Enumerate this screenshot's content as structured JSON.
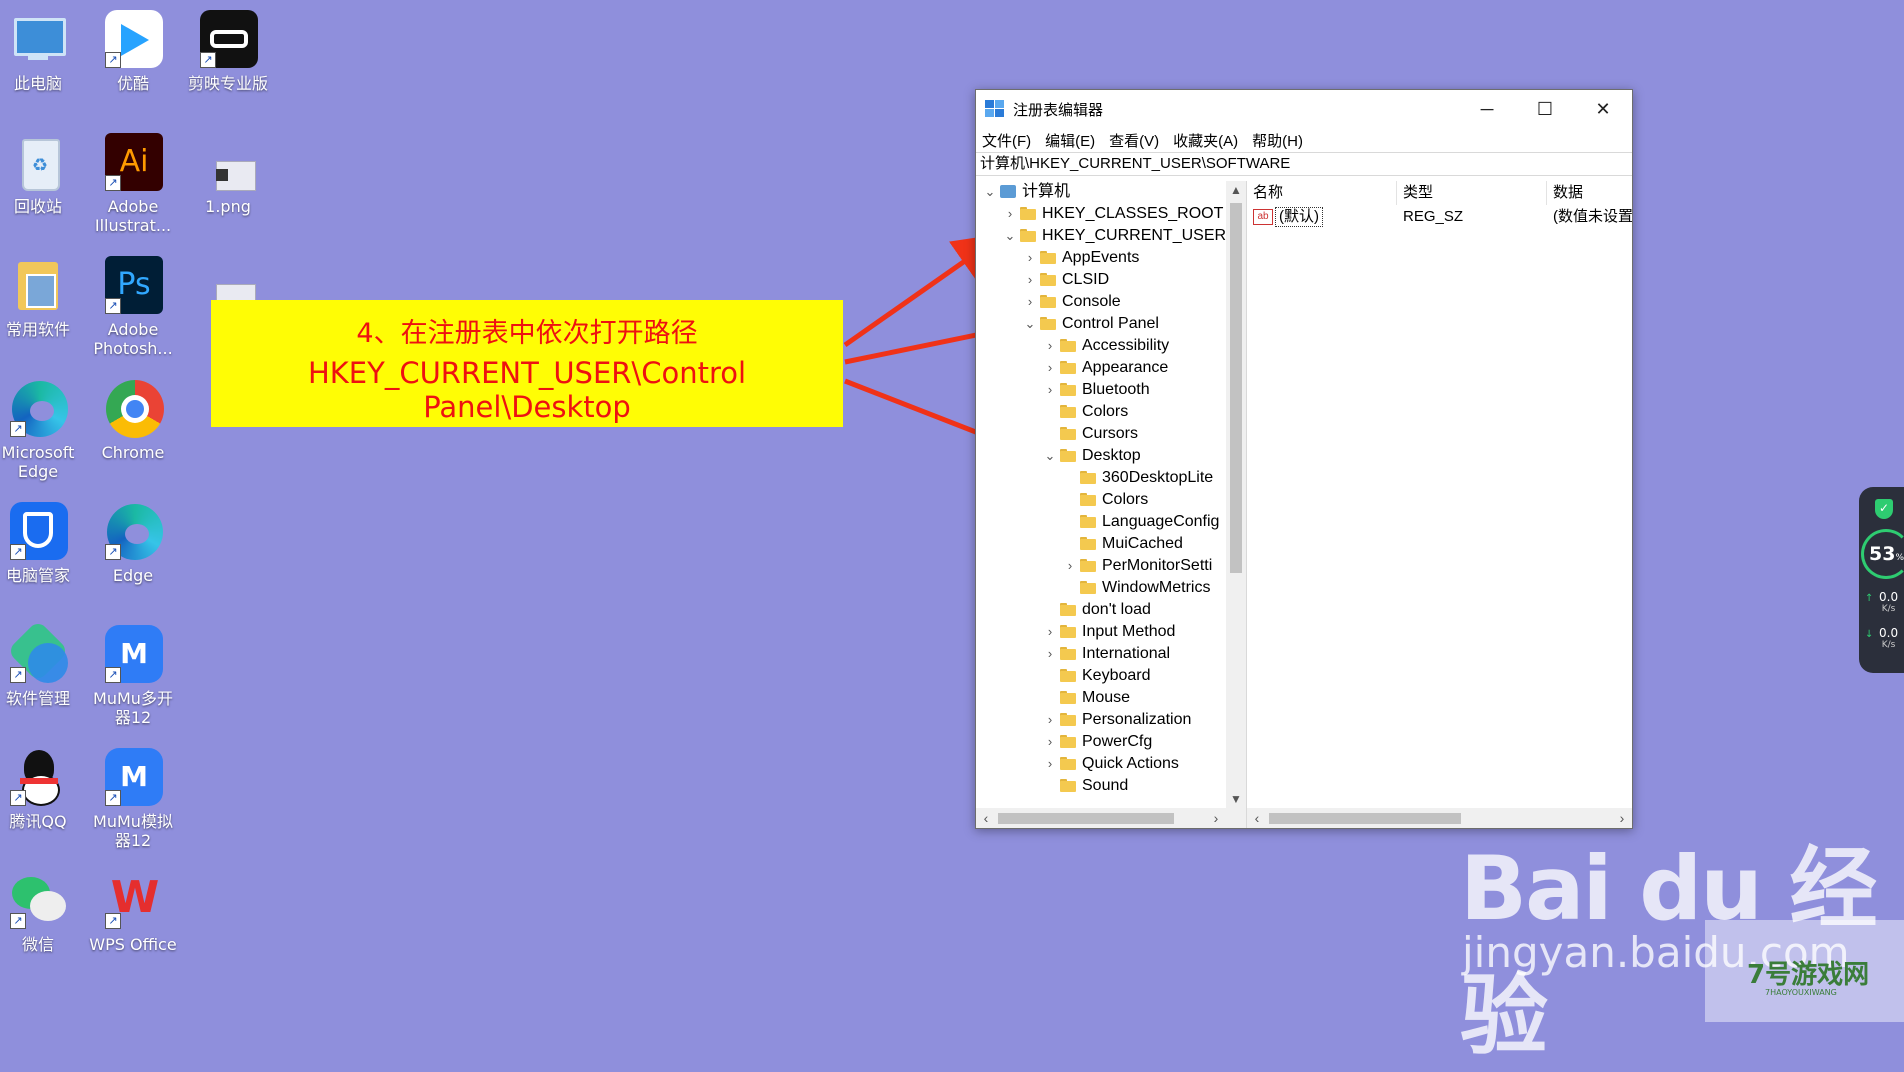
{
  "desktop": {
    "icons": [
      {
        "label": "此电脑"
      },
      {
        "label": "优酷"
      },
      {
        "label": "剪映专业版"
      },
      {
        "label": "回收站"
      },
      {
        "label": "Adobe Illustrat..."
      },
      {
        "label": "1.png"
      },
      {
        "label": "常用软件"
      },
      {
        "label": "Adobe Photosh..."
      },
      {
        "label": "Microsoft Edge"
      },
      {
        "label": "Chrome"
      },
      {
        "label": "电脑管家"
      },
      {
        "label": "Edge"
      },
      {
        "label": "软件管理"
      },
      {
        "label": "MuMu多开器12"
      },
      {
        "label": "腾讯QQ"
      },
      {
        "label": "MuMu模拟器12"
      },
      {
        "label": "微信"
      },
      {
        "label": "WPS Office"
      }
    ],
    "icon_glyphs": {
      "illustrator": "Ai",
      "photoshop": "Ps",
      "wps": "W",
      "mumu": "M"
    }
  },
  "callout": {
    "line1": "4、在注册表中依次打开路径",
    "line2": "HKEY_CURRENT_USER\\Control Panel\\Desktop",
    "background": "#fffd05",
    "text_color": "#ee1111",
    "arrow_color": "#f03218"
  },
  "regedit": {
    "title": "注册表编辑器",
    "window_buttons": {
      "minimize": "─",
      "maximize": "☐",
      "close": "✕"
    },
    "menu": [
      "文件(F)",
      "编辑(E)",
      "查看(V)",
      "收藏夹(A)",
      "帮助(H)"
    ],
    "address": "计算机\\HKEY_CURRENT_USER\\SOFTWARE",
    "tree": [
      {
        "label": "计算机",
        "level": 0,
        "expander": "v",
        "icon": "computer"
      },
      {
        "label": "HKEY_CLASSES_ROOT",
        "level": 1,
        "expander": ">"
      },
      {
        "label": "HKEY_CURRENT_USER",
        "level": 1,
        "expander": "v"
      },
      {
        "label": "AppEvents",
        "level": 2,
        "expander": ">"
      },
      {
        "label": "CLSID",
        "level": 2,
        "expander": ">"
      },
      {
        "label": "Console",
        "level": 2,
        "expander": ">"
      },
      {
        "label": "Control Panel",
        "level": 2,
        "expander": "v"
      },
      {
        "label": "Accessibility",
        "level": 3,
        "expander": ">"
      },
      {
        "label": "Appearance",
        "level": 3,
        "expander": ">"
      },
      {
        "label": "Bluetooth",
        "level": 3,
        "expander": ">"
      },
      {
        "label": "Colors",
        "level": 3,
        "expander": ""
      },
      {
        "label": "Cursors",
        "level": 3,
        "expander": ""
      },
      {
        "label": "Desktop",
        "level": 3,
        "expander": "v"
      },
      {
        "label": "360DesktopLite",
        "level": 4,
        "expander": ""
      },
      {
        "label": "Colors",
        "level": 4,
        "expander": ""
      },
      {
        "label": "LanguageConfig",
        "level": 4,
        "expander": ""
      },
      {
        "label": "MuiCached",
        "level": 4,
        "expander": ""
      },
      {
        "label": "PerMonitorSetti",
        "level": 4,
        "expander": ">"
      },
      {
        "label": "WindowMetrics",
        "level": 4,
        "expander": ""
      },
      {
        "label": "don't load",
        "level": 3,
        "expander": ""
      },
      {
        "label": "Input Method",
        "level": 3,
        "expander": ">"
      },
      {
        "label": "International",
        "level": 3,
        "expander": ">"
      },
      {
        "label": "Keyboard",
        "level": 3,
        "expander": ""
      },
      {
        "label": "Mouse",
        "level": 3,
        "expander": ""
      },
      {
        "label": "Personalization",
        "level": 3,
        "expander": ">"
      },
      {
        "label": "PowerCfg",
        "level": 3,
        "expander": ">"
      },
      {
        "label": "Quick Actions",
        "level": 3,
        "expander": ">"
      },
      {
        "label": "Sound",
        "level": 3,
        "expander": ""
      }
    ],
    "columns": {
      "name": "名称",
      "type": "类型",
      "data": "数据"
    },
    "values": [
      {
        "name": "(默认)",
        "type": "REG_SZ",
        "data": "(数值未设置)",
        "icon": "ab"
      }
    ]
  },
  "widget": {
    "percent": "53",
    "percent_unit": "%",
    "upload": "0.0",
    "download": "0.0",
    "speed_unit": "K/s"
  },
  "watermark": {
    "baidu": "Bai du 经验",
    "url": "jingyan.baidu.com",
    "game": "7号游戏网",
    "game_sub": "7HAOYOUXIWANG"
  }
}
